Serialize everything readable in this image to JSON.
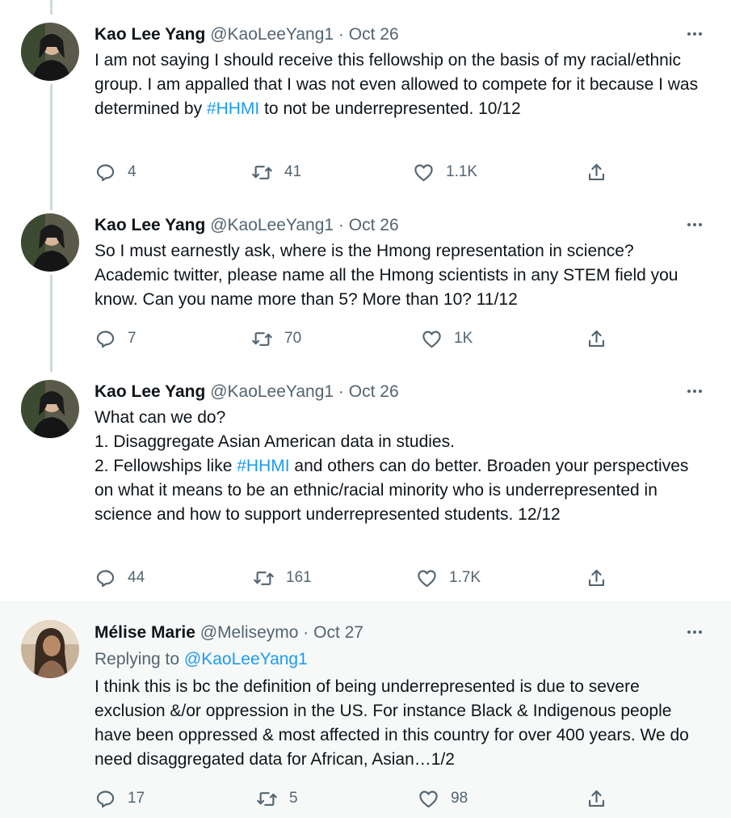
{
  "tweets": [
    {
      "name": "Kao Lee Yang",
      "handle": "@KaoLeeYang1",
      "sep": "·",
      "date": "Oct 26",
      "text_a": "I am not saying I should receive this fellowship on the basis of my racial/ethnic group. I am appalled that I was not even allowed to compete for it because I was determined by ",
      "link": "#HHMI",
      "text_b": " to not be underrepresented. 10/12",
      "replies": "4",
      "retweets": "41",
      "likes": "1.1K"
    },
    {
      "name": "Kao Lee Yang",
      "handle": "@KaoLeeYang1",
      "sep": "·",
      "date": "Oct 26",
      "text": "So I must earnestly ask, where is the Hmong representation in science? Academic twitter, please name all the Hmong scientists in any STEM field you know. Can you name more than 5? More than 10? 11/12",
      "replies": "7",
      "retweets": "70",
      "likes": "1K"
    },
    {
      "name": "Kao Lee Yang",
      "handle": "@KaoLeeYang1",
      "sep": "·",
      "date": "Oct 26",
      "line1": "What can we do?",
      "line2": "1. Disaggregate Asian American data in studies.",
      "line3_a": "2. Fellowships like ",
      "link": "#HHMI",
      "line3_b": " and others can do better. Broaden your perspectives on what it means to be an ethnic/racial minority who is underrepresented in science and how to support underrepresented students. 12/12",
      "replies": "44",
      "retweets": "161",
      "likes": "1.7K"
    },
    {
      "name": "Mélise Marie",
      "handle": "@Meliseymo",
      "sep": "·",
      "date": "Oct 27",
      "replying_prefix": "Replying to ",
      "replying_handle": "@KaoLeeYang1",
      "text": "I think this is bc the definition of being underrepresented is due to severe exclusion &/or oppression in the US. For instance Black & Indigenous people have been oppressed & most affected in this country for over 400 years. We do need disaggregated data for African, Asian…1/2",
      "replies": "17",
      "retweets": "5",
      "likes": "98"
    }
  ],
  "icons": {
    "more": "more-horizontal-icon",
    "reply": "reply-icon",
    "retweet": "retweet-icon",
    "like": "heart-icon",
    "share": "share-icon"
  },
  "colors": {
    "link": "#1d9bf0",
    "secondary": "#536471",
    "thread_line": "#cfd9de",
    "highlight_bg": "#f7f9f9"
  }
}
